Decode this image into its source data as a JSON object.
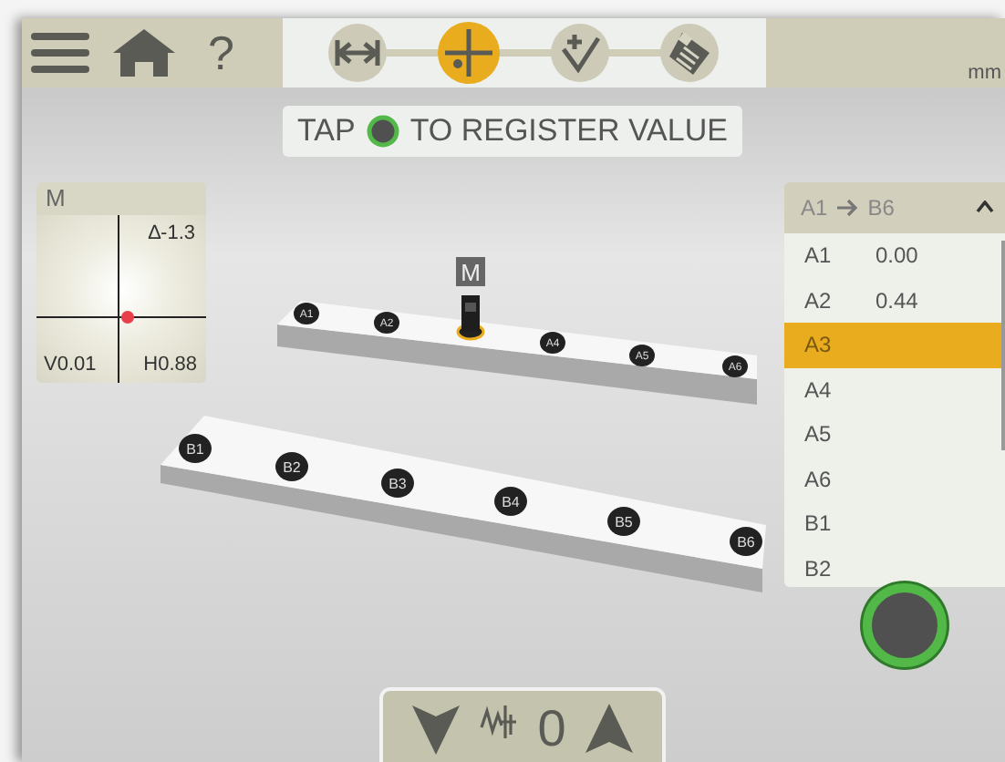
{
  "toolbar": {
    "help": "?",
    "unit": "mm",
    "steps": [
      {
        "kind": "distance",
        "selected": false
      },
      {
        "kind": "measure",
        "selected": true
      },
      {
        "kind": "check",
        "selected": false
      },
      {
        "kind": "report",
        "selected": false
      }
    ]
  },
  "instruction": {
    "before": "TAP",
    "after": "TO REGISTER VALUE"
  },
  "sensor_panel": {
    "title": "M",
    "angle": "∆-1.3",
    "vertical": "V0.01",
    "horizontal": "H0.88"
  },
  "scene": {
    "rails": [
      {
        "items": [
          {
            "kind": "marker",
            "label": "A1"
          },
          {
            "kind": "marker",
            "label": "A2"
          },
          {
            "kind": "sensor",
            "label": "M"
          },
          {
            "kind": "marker",
            "label": "A4"
          },
          {
            "kind": "marker",
            "label": "A5"
          },
          {
            "kind": "marker",
            "label": "A6"
          }
        ]
      },
      {
        "items": [
          {
            "kind": "marker",
            "label": "B1"
          },
          {
            "kind": "marker",
            "label": "B2"
          },
          {
            "kind": "marker",
            "label": "B3"
          },
          {
            "kind": "marker",
            "label": "B4"
          },
          {
            "kind": "marker",
            "label": "B5"
          },
          {
            "kind": "marker",
            "label": "B6"
          }
        ]
      }
    ]
  },
  "points_list": {
    "from": "A1",
    "to": "B6",
    "expanded": true,
    "rows": [
      {
        "name": "A1",
        "value": "0.00",
        "selected": false
      },
      {
        "name": "A2",
        "value": "0.44",
        "selected": false
      },
      {
        "name": "A3",
        "selected": true
      },
      {
        "name": "A4",
        "selected": false
      },
      {
        "name": "A5",
        "selected": false
      },
      {
        "name": "A6",
        "selected": false
      },
      {
        "name": "B1",
        "selected": false
      },
      {
        "name": "B2",
        "selected": false
      }
    ]
  },
  "readout": {
    "value": "0"
  }
}
